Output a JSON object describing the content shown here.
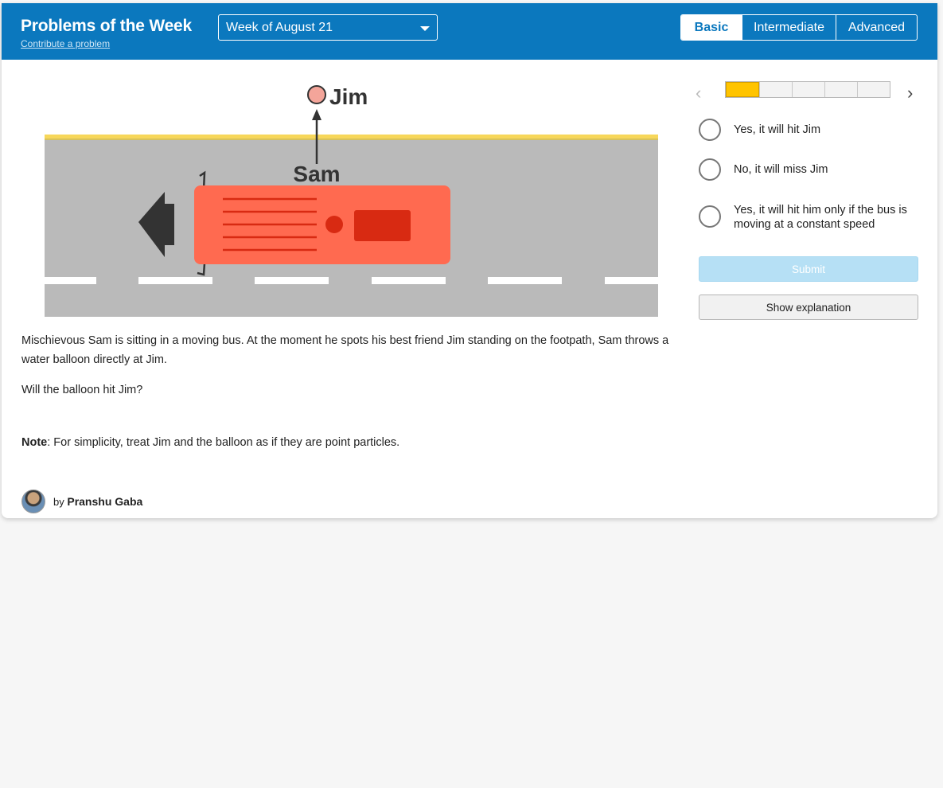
{
  "header": {
    "title": "Problems of the Week",
    "contribute_link": "Contribute a problem",
    "week_selector": {
      "selected": "Week of August 21"
    },
    "levels": [
      {
        "label": "Basic",
        "active": true
      },
      {
        "label": "Intermediate",
        "active": false
      },
      {
        "label": "Advanced",
        "active": false
      }
    ]
  },
  "illustration": {
    "labels": {
      "target": "Jim",
      "thrower": "Sam"
    },
    "colors": {
      "road": "#bababa",
      "curb": "#f7d75a",
      "bus": "#ff6a50",
      "bus_detail": "#d82a12",
      "arrow": "#333333",
      "jim": "#f4a59a"
    }
  },
  "problem": {
    "text": "Mischievous Sam is sitting in a moving bus. At the moment he spots his best friend Jim standing on the footpath, Sam throws a water balloon directly at Jim.",
    "question": "Will the balloon hit Jim?",
    "note_label": "Note",
    "note_text": ": For simplicity, treat Jim and the balloon as if they are point particles."
  },
  "author": {
    "prefix": "by",
    "name": "Pranshu Gaba"
  },
  "panel": {
    "progress": {
      "current": 1,
      "total": 5
    },
    "choices": [
      "Yes, it will hit Jim",
      "No, it will miss Jim",
      "Yes, it will hit him only if the bus is moving at a constant speed"
    ],
    "submit_label": "Submit",
    "explanation_label": "Show explanation",
    "prev_icon": "chevron-left-icon",
    "next_icon": "chevron-right-icon"
  },
  "colors": {
    "header_bg": "#0b78be",
    "progress_fill": "#ffc400",
    "submit_disabled": "#b6e0f5"
  }
}
